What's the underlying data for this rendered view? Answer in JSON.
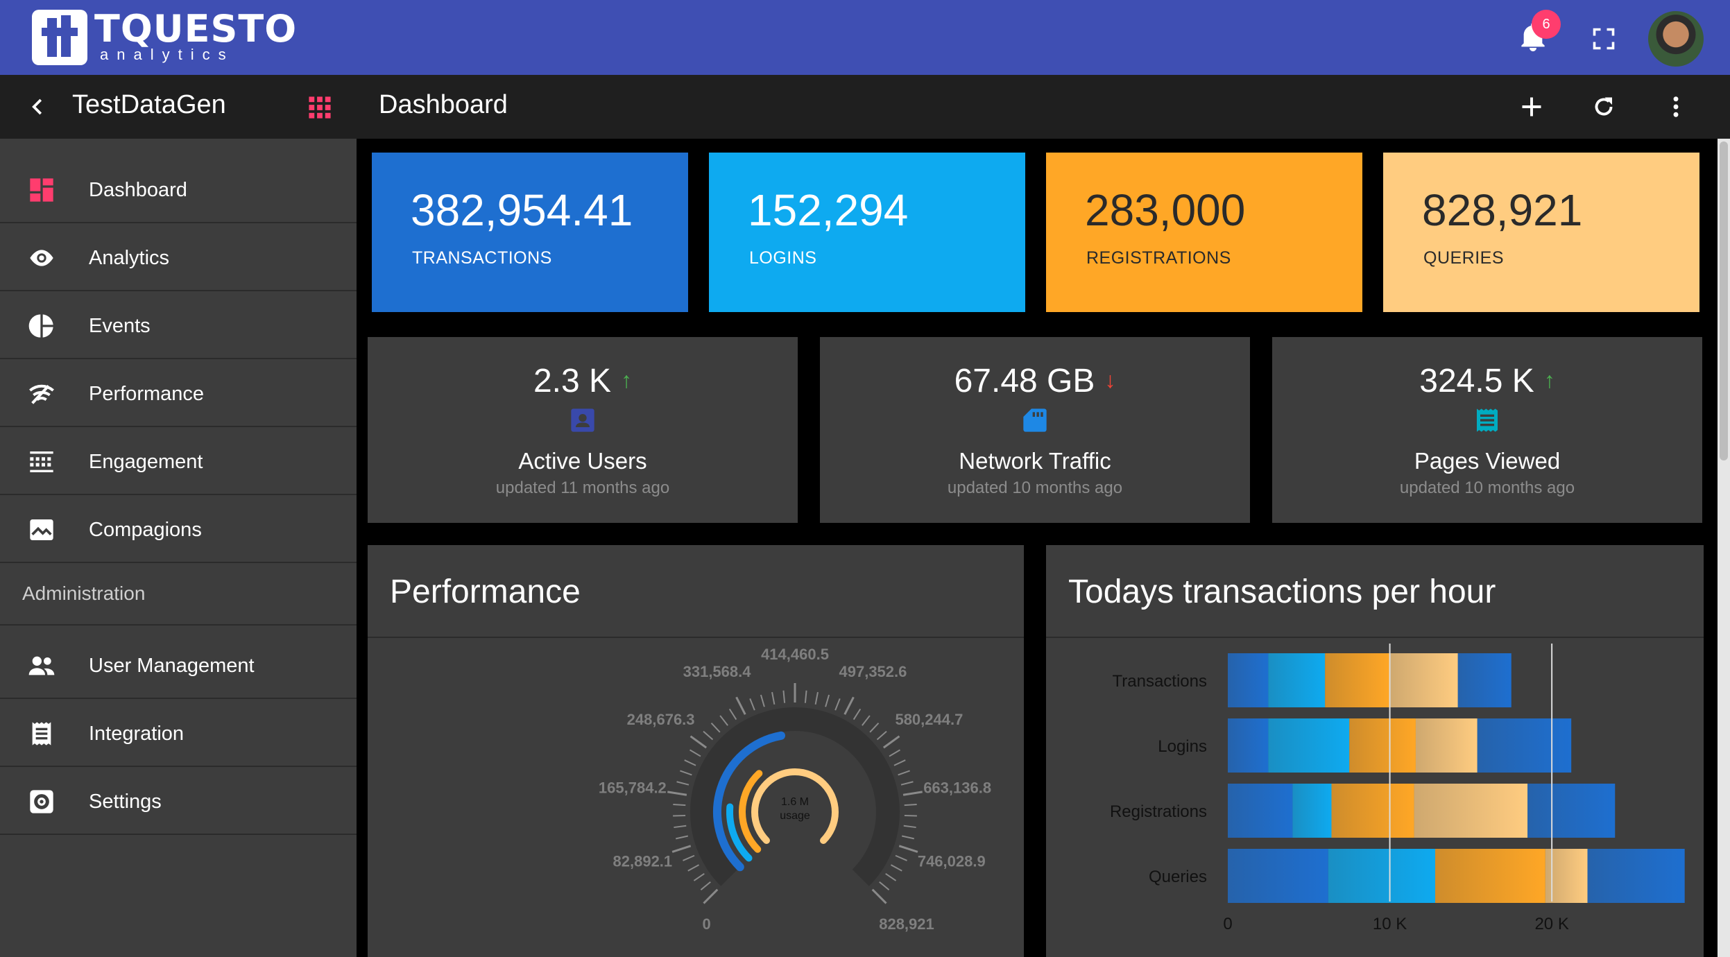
{
  "brand": {
    "name": "TQUESTO",
    "sub": "analytics"
  },
  "topbar": {
    "notifications": "6"
  },
  "sidebar": {
    "title": "TestDataGen",
    "items": [
      {
        "label": "Dashboard",
        "icon": "dashboard-icon"
      },
      {
        "label": "Analytics",
        "icon": "eye-icon"
      },
      {
        "label": "Events",
        "icon": "pie-icon"
      },
      {
        "label": "Performance",
        "icon": "wifi-icon"
      },
      {
        "label": "Engagement",
        "icon": "grid-dots-icon"
      },
      {
        "label": "Compagions",
        "icon": "chart-image-icon"
      }
    ],
    "section": "Administration",
    "admin_items": [
      {
        "label": "User Management",
        "icon": "people-icon"
      },
      {
        "label": "Integration",
        "icon": "receipt-icon"
      },
      {
        "label": "Settings",
        "icon": "settings-icon"
      }
    ]
  },
  "main": {
    "title": "Dashboard"
  },
  "tiles": [
    {
      "value": "382,954.41",
      "label": "TRANSACTIONS",
      "color": "#1e6fd0"
    },
    {
      "value": "152,294",
      "label": "LOGINS",
      "color": "#0eaaf0"
    },
    {
      "value": "283,000",
      "label": "REGISTRATIONS",
      "color": "#ffa726"
    },
    {
      "value": "828,921",
      "label": "QUERIES",
      "color": "#ffcc80"
    }
  ],
  "kpis": [
    {
      "value": "2.3 K",
      "trend": "↑",
      "trend_color": "#4caf50",
      "label": "Active Users",
      "updated": "updated 11 months ago",
      "icon_color": "#3949ab"
    },
    {
      "value": "67.48 GB",
      "trend": "↓",
      "trend_color": "#f44336",
      "label": "Network Traffic",
      "updated": "updated 10 months ago",
      "icon_color": "#1e88e5"
    },
    {
      "value": "324.5 K",
      "trend": "↑",
      "trend_color": "#4caf50",
      "label": "Pages Viewed",
      "updated": "updated 10 months ago",
      "icon_color": "#00acc1"
    }
  ],
  "performance": {
    "title": "Performance",
    "center_value": "1.6 M",
    "center_label": "usage",
    "scale_labels": [
      "0",
      "82,892.1",
      "165,784.2",
      "248,676.3",
      "331,568.4",
      "414,460.5",
      "497,352.6",
      "580,244.7",
      "663,136.8",
      "746,028.9",
      "828,921"
    ],
    "scale_max": 828921,
    "arcs": [
      {
        "color": "#1e6fd0",
        "value": 382954.41
      },
      {
        "color": "#0eaaf0",
        "value": 152294
      },
      {
        "color": "#ffa726",
        "value": 283000
      },
      {
        "color": "#ffcc80",
        "value": 828921
      }
    ]
  },
  "chart_data": {
    "type": "bar",
    "title": "Todays transactions per hour",
    "orientation": "horizontal",
    "stacked": true,
    "categories": [
      "Transactions",
      "Logins",
      "Registrations",
      "Queries"
    ],
    "x_ticks": [
      "0",
      "10 K",
      "20 K"
    ],
    "xlim": [
      0,
      28000
    ],
    "series": [
      {
        "color": "#1e6fd0",
        "values": [
          2500,
          2500,
          4000,
          6200
        ]
      },
      {
        "color": "#0eaaf0",
        "values": [
          3500,
          5000,
          2400,
          6600
        ]
      },
      {
        "color": "#ffa726",
        "values": [
          4000,
          4100,
          5100,
          6800
        ]
      },
      {
        "color": "#ffcc80",
        "values": [
          4200,
          3800,
          7000,
          2600
        ]
      },
      {
        "color": "#1e6fd0",
        "values": [
          3300,
          5800,
          5400,
          6000
        ]
      }
    ]
  }
}
